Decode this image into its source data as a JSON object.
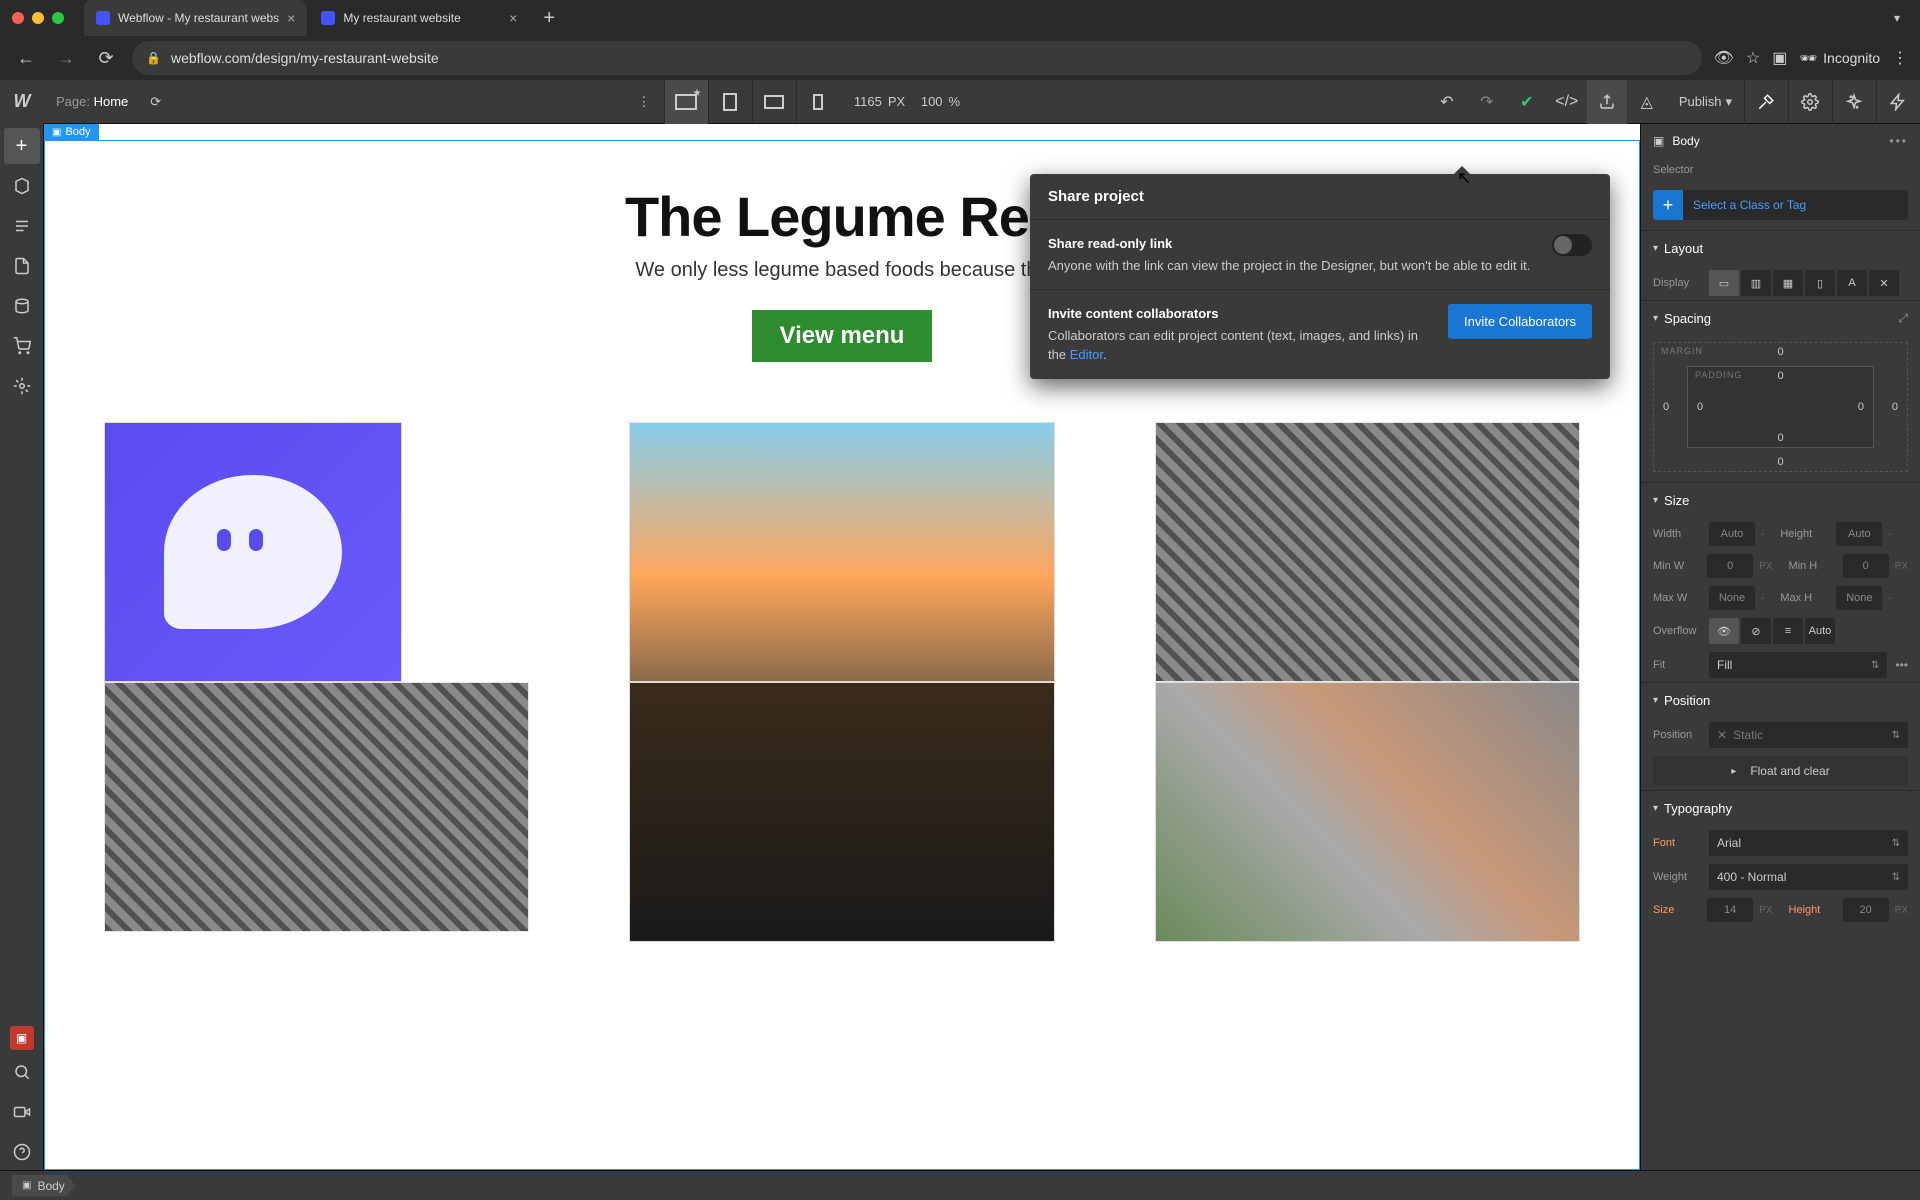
{
  "browser": {
    "tabs": [
      {
        "title": "Webflow - My restaurant webs"
      },
      {
        "title": "My restaurant website"
      }
    ],
    "url": "webflow.com/design/my-restaurant-website",
    "incognito_label": "Incognito"
  },
  "topbar": {
    "page_label": "Page:",
    "page_name": "Home",
    "width_px": "1165",
    "width_unit": "PX",
    "zoom": "100",
    "zoom_unit": "%",
    "publish_label": "Publish"
  },
  "canvas": {
    "body_label": "Body",
    "site_title": "The Legume Res",
    "site_sub": "We only less legume based foods because tha",
    "menu_btn": "View menu"
  },
  "popover": {
    "title": "Share project",
    "readonly_heading": "Share read-only link",
    "readonly_desc": "Anyone with the link can view the project in the Designer, but won't be able to edit it.",
    "collab_heading": "Invite content collaborators",
    "collab_desc_1": "Collaborators can edit project content (text, images, and links) in the ",
    "collab_link": "Editor",
    "collab_desc_2": ".",
    "invite_btn": "Invite Collaborators"
  },
  "right_panel": {
    "element_label": "Body",
    "selector_label": "Selector",
    "selector_placeholder": "Select a Class or Tag",
    "sections": {
      "layout": "Layout",
      "spacing": "Spacing",
      "size": "Size",
      "position": "Position",
      "typography": "Typography"
    },
    "layout": {
      "display_label": "Display"
    },
    "spacing": {
      "margin_label": "MARGIN",
      "padding_label": "PADDING",
      "m_top": "0",
      "m_right": "0",
      "m_bottom": "0",
      "m_left": "0",
      "p_top": "0",
      "p_right": "0",
      "p_bottom": "0",
      "p_left": "0"
    },
    "size": {
      "width_label": "Width",
      "width_val": "Auto",
      "height_label": "Height",
      "height_val": "Auto",
      "minw_label": "Min W",
      "minw_val": "0",
      "minw_unit": "PX",
      "minh_label": "Min H",
      "minh_val": "0",
      "minh_unit": "PX",
      "maxw_label": "Max W",
      "maxw_val": "None",
      "maxh_label": "Max H",
      "maxh_val": "None",
      "overflow_label": "Overflow",
      "overflow_auto": "Auto",
      "fit_label": "Fit",
      "fit_val": "Fill"
    },
    "position": {
      "position_label": "Position",
      "position_val": "Static",
      "float_label": "Float and clear"
    },
    "typography": {
      "font_label": "Font",
      "font_val": "Arial",
      "weight_label": "Weight",
      "weight_val": "400 - Normal",
      "size_label": "Size",
      "size_val": "14",
      "size_unit": "PX",
      "height_label": "Height",
      "height_val": "20",
      "height_unit": "PX"
    }
  },
  "breadcrumb": {
    "body": "Body"
  }
}
